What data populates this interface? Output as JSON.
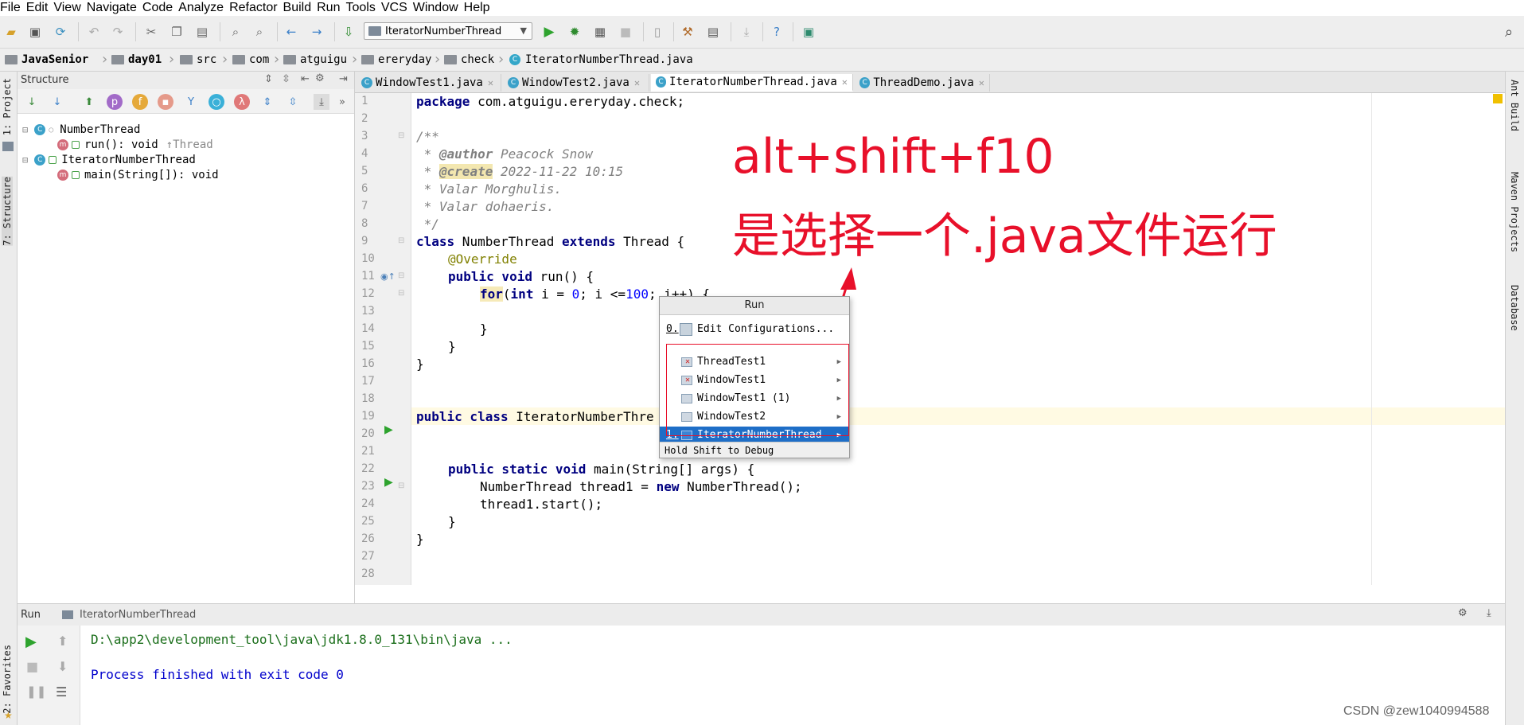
{
  "menu": [
    "File",
    "Edit",
    "View",
    "Navigate",
    "Code",
    "Analyze",
    "Refactor",
    "Build",
    "Run",
    "Tools",
    "VCS",
    "Window",
    "Help"
  ],
  "toolbar": {
    "run_config": "IteratorNumberThread"
  },
  "breadcrumbs": [
    "JavaSenior",
    "day01",
    "src",
    "com",
    "atguigu",
    "ereryday",
    "check",
    "IteratorNumberThread.java"
  ],
  "sidebar": {
    "project_tab": "1: Project",
    "structure_tab": "7: Structure",
    "favorites_tab": "2: Favorites"
  },
  "right_tabs": [
    "Ant Build",
    "Maven Projects",
    "Database"
  ],
  "structure": {
    "title": "Structure",
    "tree": [
      {
        "name": "NumberThread"
      },
      {
        "name": "run(): void",
        "suffix": "↑Thread"
      },
      {
        "name": "IteratorNumberThread"
      },
      {
        "name": "main(String[]): void"
      }
    ]
  },
  "tabs": [
    "WindowTest1.java",
    "WindowTest2.java",
    "IteratorNumberThread.java",
    "ThreadDemo.java"
  ],
  "line_numbers": [
    "1",
    "2",
    "3",
    "4",
    "5",
    "6",
    "7",
    "8",
    "9",
    "10",
    "11",
    "12",
    "13",
    "14",
    "15",
    "16",
    "17",
    "18",
    "19",
    "20",
    "21",
    "22",
    "23",
    "24",
    "25",
    "26",
    "27",
    "28"
  ],
  "code": {
    "l1_kw": "package",
    "l1_rest": " com.atguigu.ereryday.check;",
    "l3": "/**",
    "l4_tag": "@author",
    "l4_rest": " Peacock Snow",
    "l5_tag": "@create",
    "l5_rest": " 2022-11-22 10:15",
    "l6": " * Valar Morghulis.",
    "l7": " * Valar dohaeris.",
    "l8": " */",
    "l9_kw1": "class",
    "l9_mid": " NumberThread ",
    "l9_kw2": "extends",
    "l9_rest": " Thread {",
    "l10": "@Override",
    "l11_kw": "public void",
    "l11_rest": " run() {",
    "l12_kw1": "for",
    "l12_a": "(",
    "l12_kw2": "int",
    "l12_b": " i = ",
    "l12_n1": "0",
    "l12_c": "; i <=",
    "l12_n2": "100",
    "l12_d": "; i++) {",
    "l14": "}",
    "l15": "}",
    "l16": "}",
    "l20_kw": "public class",
    "l20_rest": " IteratorNumberThre",
    "l23_kw": "public static void",
    "l23_rest": " main(String[] args) {",
    "l24_a": "NumberThread thread1 = ",
    "l24_kw": "new",
    "l24_b": " NumberThread();",
    "l25": "thread1.start();",
    "l26": "}",
    "l27": "}"
  },
  "annotation": {
    "line1": "alt+shift+f10",
    "line2": "是选择一个.java文件运行"
  },
  "popup": {
    "title": "Run",
    "edit_key": "0.",
    "edit_label": "Edit Configurations...",
    "items": [
      {
        "label": "ThreadTest1"
      },
      {
        "label": "WindowTest1"
      },
      {
        "label": "WindowTest1 (1)"
      },
      {
        "label": "WindowTest2"
      },
      {
        "key": "1.",
        "label": "IteratorNumberThread"
      }
    ],
    "hint": "Hold Shift to Debug"
  },
  "run_panel": {
    "title": "Run",
    "config": "IteratorNumberThread",
    "line1": "D:\\app2\\development_tool\\java\\jdk1.8.0_131\\bin\\java ...",
    "line2": "Process finished with exit code 0"
  },
  "watermark": "CSDN @zew1040994588",
  "colors": {
    "annotation": "#e8102a",
    "selection": "#1e6ec7",
    "keyword": "#000080",
    "console_path": "#1a6e1a",
    "console_text": "#0000cc"
  }
}
